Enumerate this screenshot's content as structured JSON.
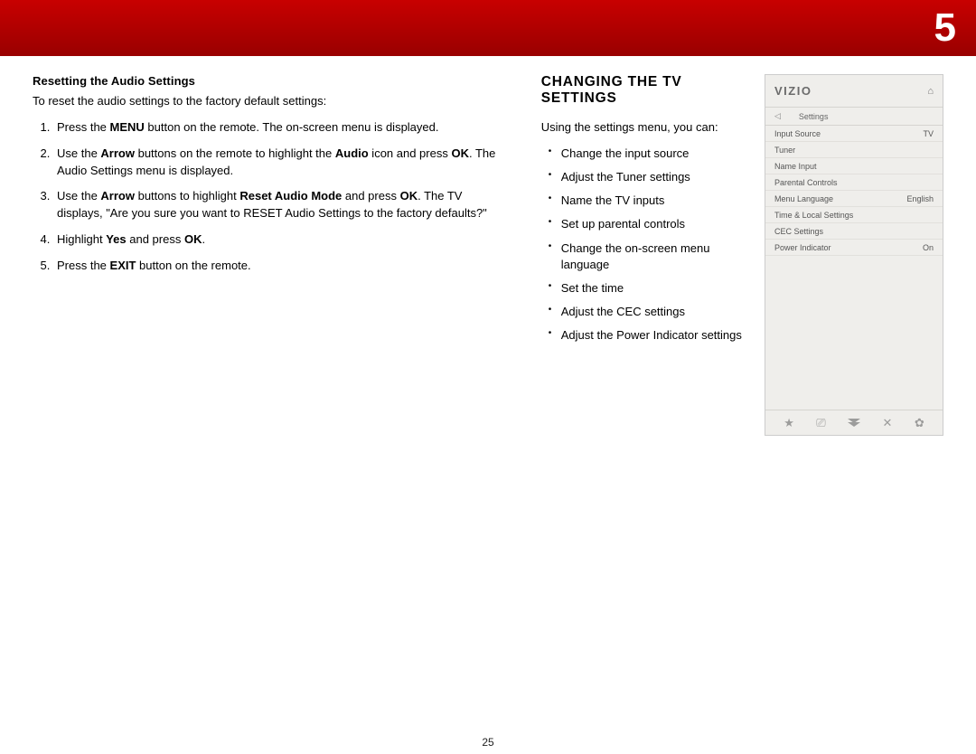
{
  "banner": {
    "section_number": "5"
  },
  "page_number": "25",
  "left": {
    "heading": "Resetting the Audio Settings",
    "intro": "To reset the audio settings to the factory default settings:",
    "steps": [
      {
        "pre": "Press the ",
        "bold1": "MENU",
        "mid1": " button on the remote. The on-screen menu is displayed."
      },
      {
        "pre": "Use the ",
        "bold1": "Arrow",
        "mid1": " buttons on the remote to highlight the ",
        "bold2": "Audio",
        "mid2": " icon and press ",
        "bold3": "OK",
        "mid3": ". The Audio Settings menu is displayed."
      },
      {
        "pre": "Use the ",
        "bold1": "Arrow",
        "mid1": " buttons to highlight ",
        "bold2": "Reset Audio Mode",
        "mid2": " and press ",
        "bold3": "OK",
        "mid3": ". The TV displays, \"Are you sure you want to RESET Audio Settings to the factory defaults?\""
      },
      {
        "pre": "Highlight ",
        "bold1": "Yes",
        "mid1": " and press ",
        "bold2": "OK",
        "mid2": "."
      },
      {
        "pre": "Press the ",
        "bold1": "EXIT",
        "mid1": " button on the remote."
      }
    ]
  },
  "right": {
    "heading": "CHANGING THE TV SETTINGS",
    "intro": "Using the settings menu, you can:",
    "bullets": [
      "Change the input source",
      "Adjust the Tuner settings",
      "Name the TV inputs",
      "Set up parental controls",
      "Change the on-screen menu language",
      "Set the time",
      "Adjust the CEC settings",
      "Adjust the Power Indicator settings"
    ]
  },
  "osd": {
    "logo": "VIZIO",
    "breadcrumb_back": "◁",
    "breadcrumb": "Settings",
    "items": [
      {
        "label": "Input Source",
        "value": "TV"
      },
      {
        "label": "Tuner",
        "value": ""
      },
      {
        "label": "Name Input",
        "value": ""
      },
      {
        "label": "Parental Controls",
        "value": ""
      },
      {
        "label": "Menu Language",
        "value": "English"
      },
      {
        "label": "Time & Local Settings",
        "value": ""
      },
      {
        "label": "CEC Settings",
        "value": ""
      },
      {
        "label": "Power Indicator",
        "value": "On"
      }
    ],
    "footer_icons": {
      "star": "★",
      "cc": "⎚",
      "vchip": "double-down",
      "x": "✕",
      "gear": "✿"
    },
    "home_icon": "⌂"
  }
}
